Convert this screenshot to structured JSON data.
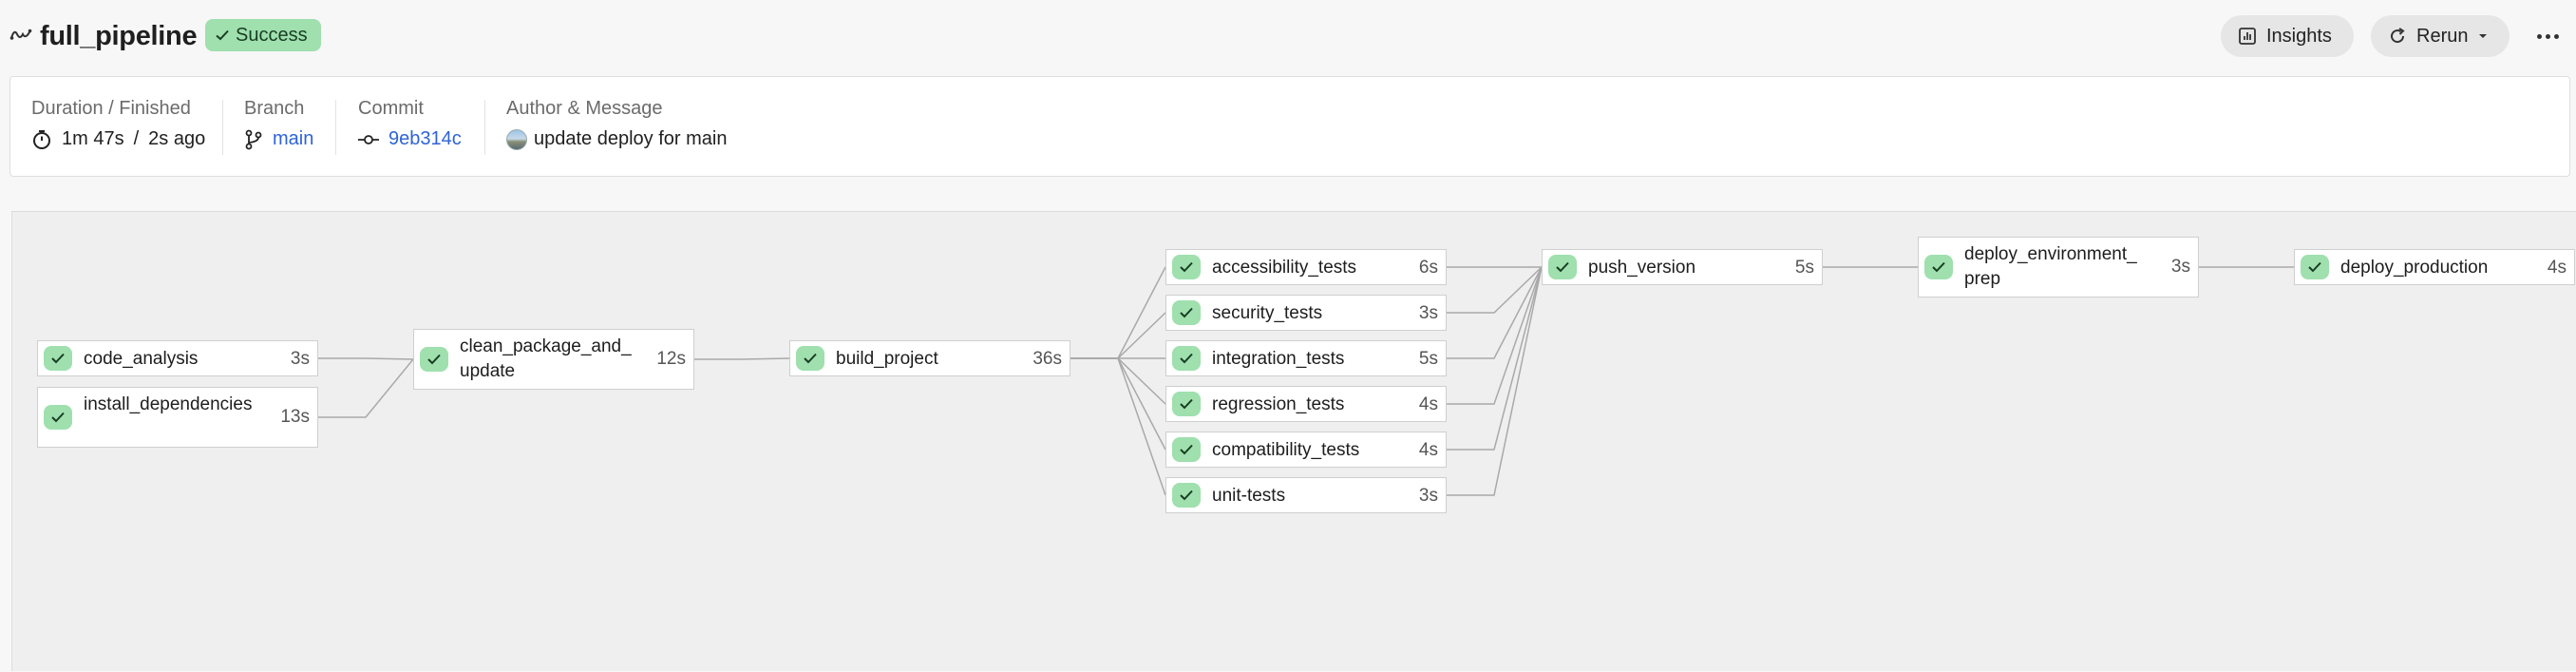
{
  "header": {
    "title": "full_pipeline",
    "status": "Success",
    "insights_label": "Insights",
    "rerun_label": "Rerun"
  },
  "info": {
    "duration_label": "Duration / Finished",
    "duration": "1m 47s",
    "separator": "/",
    "finished": "2s ago",
    "branch_label": "Branch",
    "branch": "main",
    "commit_label": "Commit",
    "commit": "9eb314c",
    "author_label": "Author & Message",
    "message": "update deploy for main"
  },
  "colors": {
    "success": "#9fe0ae",
    "link": "#2f63d8"
  },
  "jobs": [
    {
      "name": "code_analysis",
      "duration": "3s",
      "status": "success"
    },
    {
      "name": "install_dependencies",
      "duration": "13s",
      "status": "success"
    },
    {
      "name": "clean_package_and_ update",
      "duration": "12s",
      "status": "success"
    },
    {
      "name": "build_project",
      "duration": "36s",
      "status": "success"
    },
    {
      "name": "accessibility_tests",
      "duration": "6s",
      "status": "success"
    },
    {
      "name": "security_tests",
      "duration": "3s",
      "status": "success"
    },
    {
      "name": "integration_tests",
      "duration": "5s",
      "status": "success"
    },
    {
      "name": "regression_tests",
      "duration": "4s",
      "status": "success"
    },
    {
      "name": "compatibility_tests",
      "duration": "4s",
      "status": "success"
    },
    {
      "name": "unit-tests",
      "duration": "3s",
      "status": "success"
    },
    {
      "name": "push_version",
      "duration": "5s",
      "status": "success"
    },
    {
      "name": "deploy_environment_ prep",
      "duration": "3s",
      "status": "success"
    },
    {
      "name": "deploy_production",
      "duration": "4s",
      "status": "success"
    }
  ]
}
